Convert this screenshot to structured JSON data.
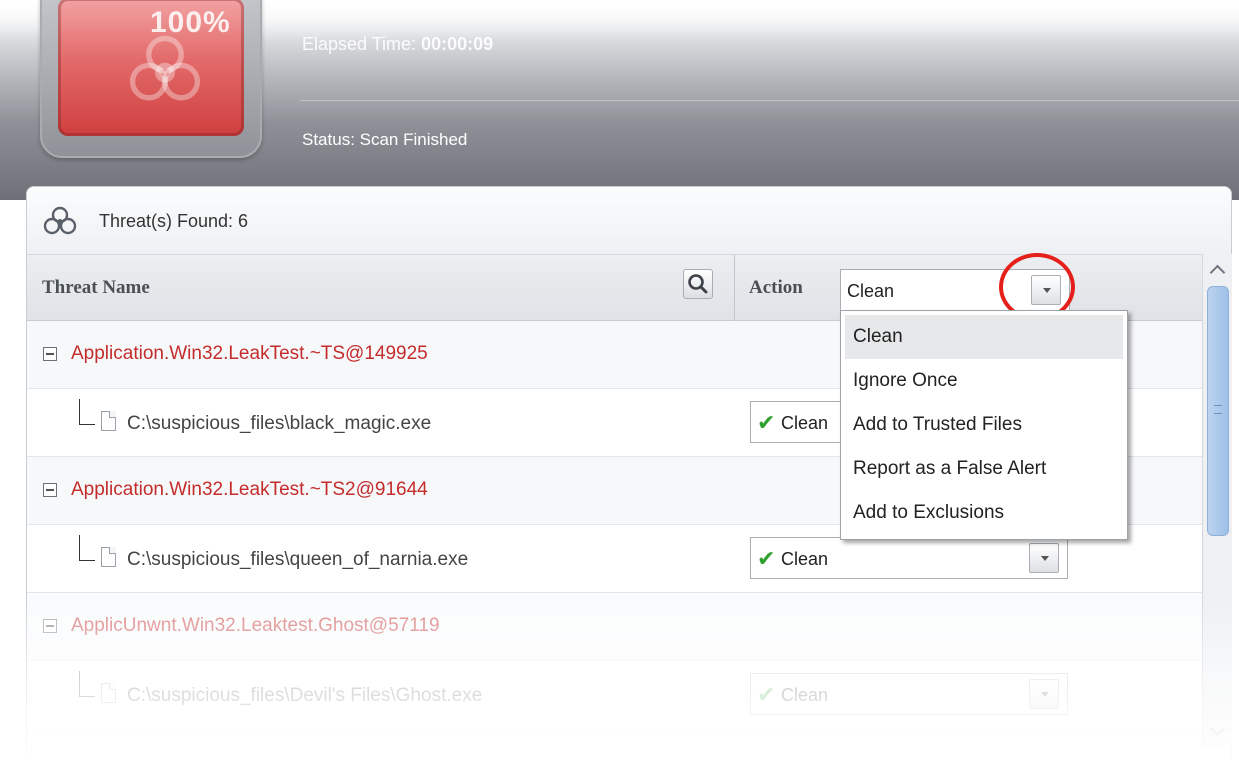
{
  "header": {
    "progress_percent": "100%",
    "elapsed_label": "Elapsed Time: ",
    "elapsed_value": "00:00:09",
    "status": "Status: Scan Finished"
  },
  "threats": {
    "found_label": "Threat(s) Found: 6"
  },
  "columns": {
    "threat_name": "Threat Name",
    "action": "Action",
    "action_value": "Clean"
  },
  "rows": [
    {
      "threat": "Application.Win32.LeakTest.~TS@149925",
      "file": "C:\\suspicious_files\\black_magic.exe",
      "action": "Clean"
    },
    {
      "threat": "Application.Win32.LeakTest.~TS2@91644",
      "file": "C:\\suspicious_files\\queen_of_narnia.exe",
      "action": "Clean"
    },
    {
      "threat": "ApplicUnwnt.Win32.Leaktest.Ghost@57119",
      "file": "C:\\suspicious_files\\Devil's Files\\Ghost.exe",
      "action": "Clean"
    }
  ],
  "dropdown": {
    "items": [
      "Clean",
      "Ignore Once",
      "Add to Trusted Files",
      "Report as a False Alert",
      "Add to Exclusions"
    ],
    "selected": "Clean"
  },
  "colors": {
    "threat_red": "#c42c2c",
    "highlight_circle": "#e5201b",
    "check_green": "#2fa12f"
  },
  "icons": [
    "biohazard-icon",
    "search-icon",
    "chevron-down-icon",
    "collapse-icon",
    "file-icon",
    "checkmark-icon",
    "scroll-up-icon",
    "scroll-down-icon"
  ]
}
